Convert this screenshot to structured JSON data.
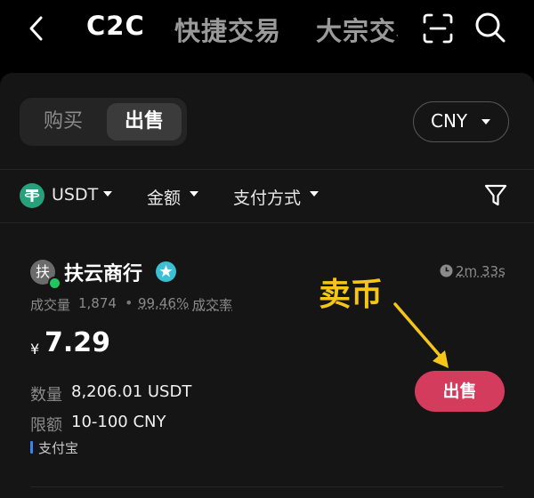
{
  "header": {
    "tabs": [
      "C2C",
      "快捷交易",
      "大宗交易"
    ],
    "icons": [
      "back-icon",
      "scan-icon",
      "search-icon"
    ]
  },
  "trade": {
    "buy_label": "购买",
    "sell_label": "出售",
    "selected": "出售",
    "currency": "CNY"
  },
  "filters": {
    "coin": "USDT",
    "amount": "金额",
    "payment": "支付方式"
  },
  "listing": {
    "avatar_char": "扶",
    "merchant": "扶云商行",
    "timer": "2m 33s",
    "volume_label": "成交量",
    "volume": "1,874",
    "completion_rate": "99.46%",
    "completion_label": "成交率",
    "currency_symbol": "¥",
    "price": "7.29",
    "quantity_label": "数量",
    "quantity": "8,206.01 USDT",
    "limit_label": "限额",
    "limit": "10-100 CNY",
    "payment_method": "支付宝",
    "action_label": "出售"
  },
  "annotation": {
    "text": "卖币"
  },
  "colors": {
    "background": "#000000",
    "panel": "#151515",
    "sell_button": "#d43c5d",
    "annotation": "#f5c518",
    "tether": "#26a17b",
    "online": "#22c55e",
    "payment_accent": "#3b82f6"
  }
}
